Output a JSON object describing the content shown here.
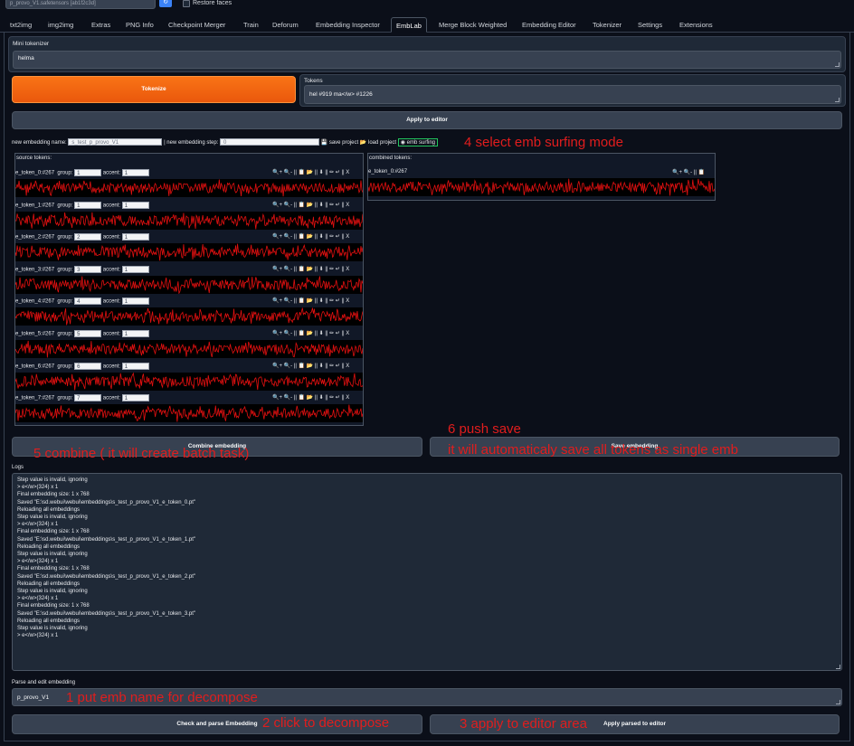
{
  "topbar": {
    "model_value": "p_provo_V1.safetensors [ab1f2c3d]",
    "restore_faces_label": "Restore faces"
  },
  "tabs": [
    "txt2img",
    "img2img",
    "Extras",
    "PNG Info",
    "Checkpoint Merger",
    "Train",
    "Deforum",
    "Embedding Inspector",
    "EmbLab",
    "Merge Block Weighted",
    "Embedding Editor",
    "Tokenizer",
    "Settings",
    "Extensions"
  ],
  "mini_tokenizer": {
    "label": "Mini tokenizer",
    "value": "helma",
    "tokenize_button": "Tokenize",
    "tokens_label": "Tokens",
    "tokens_value": "hel #919  ma</w> #1226",
    "apply_button": "Apply to editor"
  },
  "embline": {
    "new_name_label": "new embedding name:",
    "new_name_value": "s_test_p_provo_V1",
    "step_label": "| new embedding step:",
    "step_value": "0",
    "save_project": "save project",
    "load_project": "load project",
    "emb_surfing": "emb surfing"
  },
  "source": {
    "title": "source tokens:",
    "group_label": "group:",
    "accent_label": "accent:",
    "tools": "🔍+ 🔍- || 📋 📂 || ⬇ || ✏ ↵ || X",
    "rows": [
      {
        "name": "e_token_0:#267",
        "group": "1",
        "accent": "1"
      },
      {
        "name": "e_token_1:#267",
        "group": "1",
        "accent": "1"
      },
      {
        "name": "e_token_2:#267",
        "group": "2",
        "accent": "1"
      },
      {
        "name": "e_token_3:#267",
        "group": "3",
        "accent": "1"
      },
      {
        "name": "e_token_4:#267",
        "group": "4",
        "accent": "1"
      },
      {
        "name": "e_token_5:#267",
        "group": "5",
        "accent": "1"
      },
      {
        "name": "e_token_6:#267",
        "group": "6",
        "accent": "1"
      },
      {
        "name": "e_token_7:#267",
        "group": "7",
        "accent": "1"
      }
    ]
  },
  "combined": {
    "title": "combined tokens:",
    "row_name": "e_token_0:#267",
    "tools": "🔍+ 🔍- || 📋"
  },
  "buttons": {
    "combine": "Combine embedding",
    "save": "Save embedding",
    "check_parse": "Check and parse Embedding",
    "apply_parsed": "Apply parsed to editor"
  },
  "logs": {
    "label": "Logs",
    "lines": [
      "Step value is invalid, ignoring",
      "> e</w>(324) x 1",
      "Final embedding size: 1 x 768",
      "Saved \"E:\\sd.webui\\webui\\embeddings\\s_test_p_provo_V1_e_token_0.pt\"",
      "Reloading all embeddings",
      "Step value is invalid, ignoring",
      "> e</w>(324) x 1",
      "Final embedding size: 1 x 768",
      "Saved \"E:\\sd.webui\\webui\\embeddings\\s_test_p_provo_V1_e_token_1.pt\"",
      "Reloading all embeddings",
      "Step value is invalid, ignoring",
      "> e</w>(324) x 1",
      "Final embedding size: 1 x 768",
      "Saved \"E:\\sd.webui\\webui\\embeddings\\s_test_p_provo_V1_e_token_2.pt\"",
      "Reloading all embeddings",
      "Step value is invalid, ignoring",
      "> e</w>(324) x 1",
      "Final embedding size: 1 x 768",
      "Saved \"E:\\sd.webui\\webui\\embeddings\\s_test_p_provo_V1_e_token_3.pt\"",
      "Reloading all embeddings",
      "Step value is invalid, ignoring",
      "> e</w>(324) x 1"
    ]
  },
  "parse": {
    "label": "Parse and edit embedding",
    "value": "p_provo_V1"
  },
  "annotations": {
    "a1": "1 put emb name for decompose",
    "a2": "2 click to decompose",
    "a3": "3 apply to editor area",
    "a4": "4 select emb surfing mode",
    "a5": "5 combine ( it will create batch task)",
    "a6a": "6 push save",
    "a6b": "it will automaticaly save all tokens as single emb"
  },
  "colors": {
    "accent_orange": "#f97316",
    "annotation_red": "#e11d1d",
    "wave_red": "#e01010",
    "surf_green": "#22c55e"
  }
}
